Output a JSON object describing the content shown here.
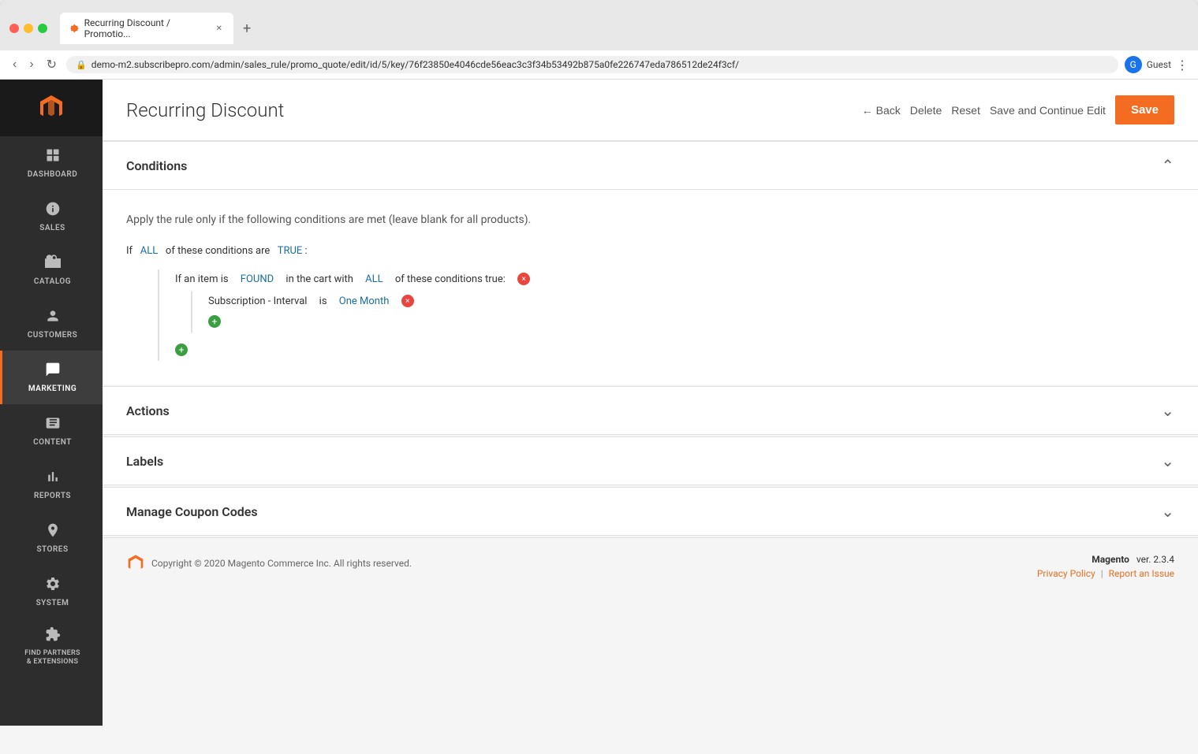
{
  "browser": {
    "tab_title": "Recurring Discount / Promotio...",
    "url": "demo-m2.subscribepro.com/admin/sales_rule/promo_quote/edit/id/5/key/76f23850e4046cde56eac3c3f34b53492b875a0fe226747eda786512de24f3cf/",
    "profile_name": "Guest"
  },
  "sidebar": {
    "items": [
      {
        "id": "dashboard",
        "label": "DASHBOARD",
        "icon": "📊"
      },
      {
        "id": "sales",
        "label": "SALES",
        "icon": "$"
      },
      {
        "id": "catalog",
        "label": "CATALOG",
        "icon": "🛍"
      },
      {
        "id": "customers",
        "label": "CUSTOMERS",
        "icon": "👤"
      },
      {
        "id": "marketing",
        "label": "MARKETING",
        "icon": "📣",
        "active": true
      },
      {
        "id": "content",
        "label": "CONTENT",
        "icon": "▦"
      },
      {
        "id": "reports",
        "label": "REPORTS",
        "icon": "📈"
      },
      {
        "id": "stores",
        "label": "STORES",
        "icon": "🏪"
      },
      {
        "id": "system",
        "label": "SYSTEM",
        "icon": "⚙"
      },
      {
        "id": "find-partners",
        "label": "FIND PARTNERS & EXTENSIONS",
        "icon": "🧩"
      }
    ]
  },
  "header": {
    "page_title": "Recurring Discount",
    "btn_back": "Back",
    "btn_delete": "Delete",
    "btn_reset": "Reset",
    "btn_save_continue": "Save and Continue Edit",
    "btn_save": "Save"
  },
  "conditions_section": {
    "title": "Conditions",
    "intro": "Apply the rule only if the following conditions are met (leave blank for all products).",
    "rule_prefix": "If",
    "rule_all": "ALL",
    "rule_middle": "of these conditions are",
    "rule_true": "TRUE",
    "rule_suffix": ":",
    "sub_rule_prefix": "If an item is",
    "sub_rule_found": "FOUND",
    "sub_rule_middle": "in the cart with",
    "sub_rule_all": "ALL",
    "sub_rule_suffix": "of these conditions true:",
    "condition_label": "Subscription - Interval",
    "condition_is": "is",
    "condition_value": "One Month"
  },
  "actions_section": {
    "title": "Actions"
  },
  "labels_section": {
    "title": "Labels"
  },
  "coupon_section": {
    "title": "Manage Coupon Codes"
  },
  "footer": {
    "copyright": "Copyright © 2020 Magento Commerce Inc. All rights reserved.",
    "magento_label": "Magento",
    "version_label": "ver. 2.3.4",
    "privacy_policy": "Privacy Policy",
    "report_issue": "Report an Issue"
  }
}
